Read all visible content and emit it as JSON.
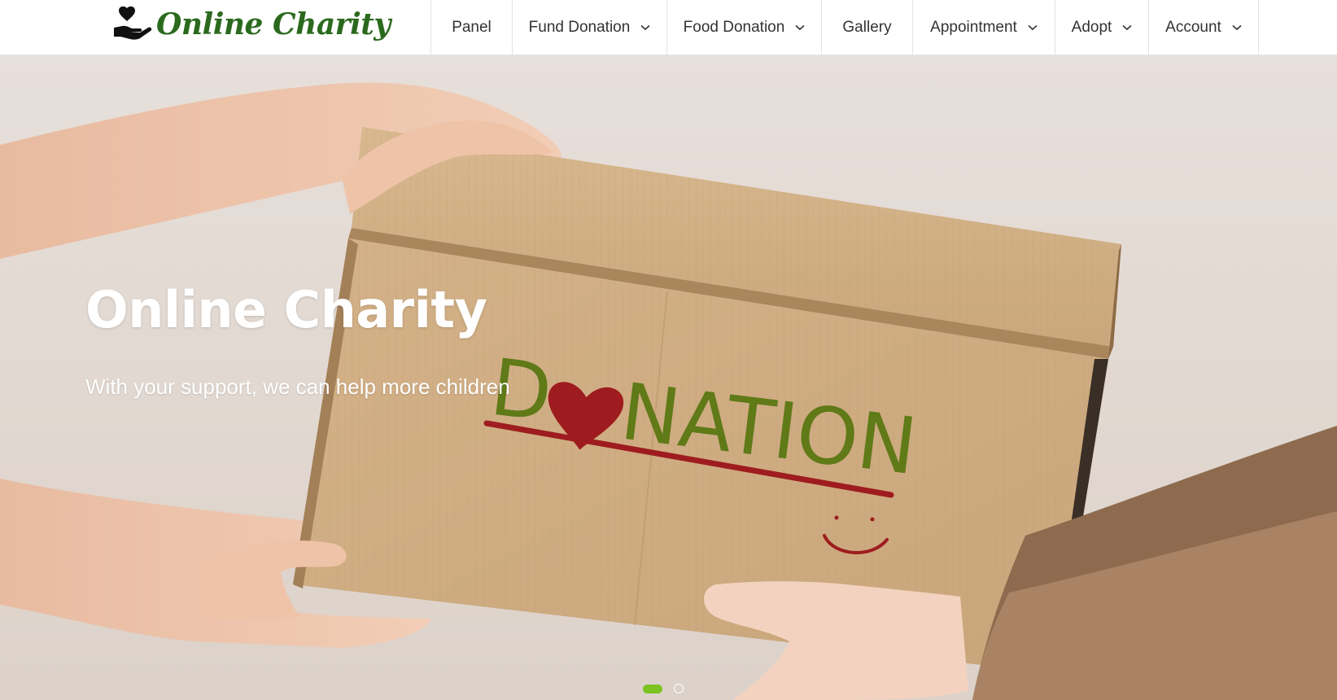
{
  "brand": {
    "name": "Online Charity",
    "logo_icon": "heart-in-hand-icon",
    "color": "#2b6a1e"
  },
  "nav": {
    "items": [
      {
        "label": "Panel",
        "has_dropdown": false
      },
      {
        "label": "Fund Donation",
        "has_dropdown": true
      },
      {
        "label": "Food Donation",
        "has_dropdown": true
      },
      {
        "label": "Gallery",
        "has_dropdown": false
      },
      {
        "label": "Appointment",
        "has_dropdown": true
      },
      {
        "label": "Adopt",
        "has_dropdown": true
      },
      {
        "label": "Account",
        "has_dropdown": true
      }
    ]
  },
  "hero": {
    "title": "Online Charity",
    "subtitle": "With your support, we can help more children",
    "box_text": "DONATION",
    "slides_total": 2,
    "active_slide": 1,
    "accent_color": "#7cc221"
  }
}
